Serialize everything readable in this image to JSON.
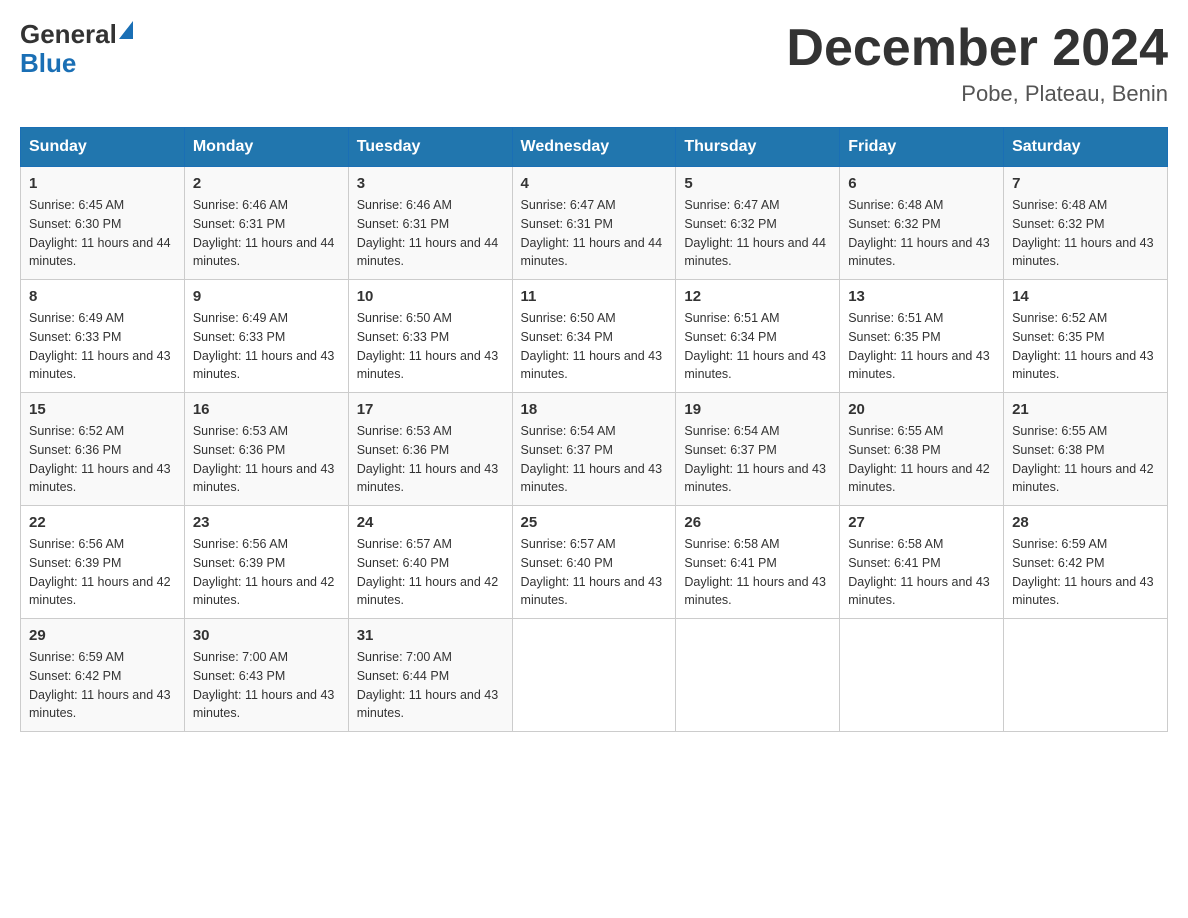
{
  "header": {
    "logo_general": "General",
    "logo_blue": "Blue",
    "month_year": "December 2024",
    "location": "Pobe, Plateau, Benin"
  },
  "days_of_week": [
    "Sunday",
    "Monday",
    "Tuesday",
    "Wednesday",
    "Thursday",
    "Friday",
    "Saturday"
  ],
  "weeks": [
    [
      {
        "day": "1",
        "sunrise": "6:45 AM",
        "sunset": "6:30 PM",
        "daylight": "11 hours and 44 minutes."
      },
      {
        "day": "2",
        "sunrise": "6:46 AM",
        "sunset": "6:31 PM",
        "daylight": "11 hours and 44 minutes."
      },
      {
        "day": "3",
        "sunrise": "6:46 AM",
        "sunset": "6:31 PM",
        "daylight": "11 hours and 44 minutes."
      },
      {
        "day": "4",
        "sunrise": "6:47 AM",
        "sunset": "6:31 PM",
        "daylight": "11 hours and 44 minutes."
      },
      {
        "day": "5",
        "sunrise": "6:47 AM",
        "sunset": "6:32 PM",
        "daylight": "11 hours and 44 minutes."
      },
      {
        "day": "6",
        "sunrise": "6:48 AM",
        "sunset": "6:32 PM",
        "daylight": "11 hours and 43 minutes."
      },
      {
        "day": "7",
        "sunrise": "6:48 AM",
        "sunset": "6:32 PM",
        "daylight": "11 hours and 43 minutes."
      }
    ],
    [
      {
        "day": "8",
        "sunrise": "6:49 AM",
        "sunset": "6:33 PM",
        "daylight": "11 hours and 43 minutes."
      },
      {
        "day": "9",
        "sunrise": "6:49 AM",
        "sunset": "6:33 PM",
        "daylight": "11 hours and 43 minutes."
      },
      {
        "day": "10",
        "sunrise": "6:50 AM",
        "sunset": "6:33 PM",
        "daylight": "11 hours and 43 minutes."
      },
      {
        "day": "11",
        "sunrise": "6:50 AM",
        "sunset": "6:34 PM",
        "daylight": "11 hours and 43 minutes."
      },
      {
        "day": "12",
        "sunrise": "6:51 AM",
        "sunset": "6:34 PM",
        "daylight": "11 hours and 43 minutes."
      },
      {
        "day": "13",
        "sunrise": "6:51 AM",
        "sunset": "6:35 PM",
        "daylight": "11 hours and 43 minutes."
      },
      {
        "day": "14",
        "sunrise": "6:52 AM",
        "sunset": "6:35 PM",
        "daylight": "11 hours and 43 minutes."
      }
    ],
    [
      {
        "day": "15",
        "sunrise": "6:52 AM",
        "sunset": "6:36 PM",
        "daylight": "11 hours and 43 minutes."
      },
      {
        "day": "16",
        "sunrise": "6:53 AM",
        "sunset": "6:36 PM",
        "daylight": "11 hours and 43 minutes."
      },
      {
        "day": "17",
        "sunrise": "6:53 AM",
        "sunset": "6:36 PM",
        "daylight": "11 hours and 43 minutes."
      },
      {
        "day": "18",
        "sunrise": "6:54 AM",
        "sunset": "6:37 PM",
        "daylight": "11 hours and 43 minutes."
      },
      {
        "day": "19",
        "sunrise": "6:54 AM",
        "sunset": "6:37 PM",
        "daylight": "11 hours and 43 minutes."
      },
      {
        "day": "20",
        "sunrise": "6:55 AM",
        "sunset": "6:38 PM",
        "daylight": "11 hours and 42 minutes."
      },
      {
        "day": "21",
        "sunrise": "6:55 AM",
        "sunset": "6:38 PM",
        "daylight": "11 hours and 42 minutes."
      }
    ],
    [
      {
        "day": "22",
        "sunrise": "6:56 AM",
        "sunset": "6:39 PM",
        "daylight": "11 hours and 42 minutes."
      },
      {
        "day": "23",
        "sunrise": "6:56 AM",
        "sunset": "6:39 PM",
        "daylight": "11 hours and 42 minutes."
      },
      {
        "day": "24",
        "sunrise": "6:57 AM",
        "sunset": "6:40 PM",
        "daylight": "11 hours and 42 minutes."
      },
      {
        "day": "25",
        "sunrise": "6:57 AM",
        "sunset": "6:40 PM",
        "daylight": "11 hours and 43 minutes."
      },
      {
        "day": "26",
        "sunrise": "6:58 AM",
        "sunset": "6:41 PM",
        "daylight": "11 hours and 43 minutes."
      },
      {
        "day": "27",
        "sunrise": "6:58 AM",
        "sunset": "6:41 PM",
        "daylight": "11 hours and 43 minutes."
      },
      {
        "day": "28",
        "sunrise": "6:59 AM",
        "sunset": "6:42 PM",
        "daylight": "11 hours and 43 minutes."
      }
    ],
    [
      {
        "day": "29",
        "sunrise": "6:59 AM",
        "sunset": "6:42 PM",
        "daylight": "11 hours and 43 minutes."
      },
      {
        "day": "30",
        "sunrise": "7:00 AM",
        "sunset": "6:43 PM",
        "daylight": "11 hours and 43 minutes."
      },
      {
        "day": "31",
        "sunrise": "7:00 AM",
        "sunset": "6:44 PM",
        "daylight": "11 hours and 43 minutes."
      },
      null,
      null,
      null,
      null
    ]
  ],
  "labels": {
    "sunrise": "Sunrise:",
    "sunset": "Sunset:",
    "daylight": "Daylight:"
  }
}
